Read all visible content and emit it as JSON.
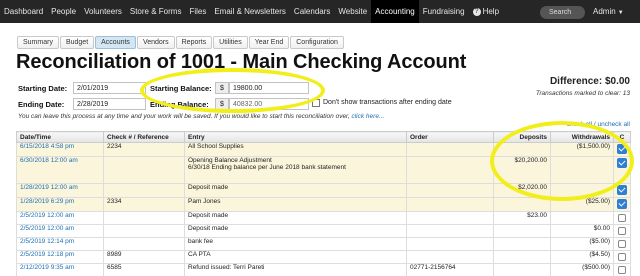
{
  "nav": {
    "items": [
      "Dashboard",
      "People",
      "Volunteers",
      "Store & Forms",
      "Files",
      "Email & Newsletters",
      "Calendars",
      "Website",
      "Accounting",
      "Fundraising"
    ],
    "active": "Accounting",
    "help": "Help",
    "search": "Search",
    "admin": "Admin"
  },
  "subtabs": [
    "Summary",
    "Budget",
    "Accounts",
    "Vendors",
    "Reports",
    "Utilities",
    "Year End",
    "Configuration"
  ],
  "active_subtab": "Accounts",
  "title": "Reconciliation of 1001 - Main Checking Account",
  "starting_date_label": "Starting Date:",
  "starting_date": "2/01/2019",
  "ending_date_label": "Ending Date:",
  "ending_date": "2/28/2019",
  "starting_balance_label": "Starting Balance:",
  "starting_balance": "19800.00",
  "ending_balance_label": "Ending Balance:",
  "ending_balance": "40832.00",
  "currency": "$",
  "dont_show_label": "Don't show transactions after ending date",
  "difference": "Difference: $0.00",
  "marked_to_clear": "Transactions marked to clear: 13",
  "note": "You can leave this process at any time and your work will be saved. If you would like to start this reconciliation over,",
  "note_link": "click here...",
  "check_all": "check all",
  "uncheck_all": "uncheck all",
  "check_sep": " / ",
  "columns": [
    "Date/Time",
    "Check # / Reference",
    "Entry",
    "Order",
    "Deposits",
    "Withdrawals",
    "C"
  ],
  "rows": [
    {
      "date": "6/15/2018 4:58 pm",
      "ref": "2234",
      "entry": "All School Supplies",
      "entry2": "",
      "order": "",
      "deposit": "",
      "withdrawal": "($1,500.00)",
      "cleared": true
    },
    {
      "date": "6/30/2018 12:00 am",
      "ref": "",
      "entry": "Opening Balance Adjustment",
      "entry2": "6/30/18 Ending balance per June 2018 bank statement",
      "order": "",
      "deposit": "$20,200.00",
      "withdrawal": "",
      "cleared": true
    },
    {
      "date": "1/28/2019 12:00 am",
      "ref": "",
      "entry": "Deposit made",
      "entry2": "",
      "order": "",
      "deposit": "$2,020.00",
      "withdrawal": "",
      "cleared": true
    },
    {
      "date": "1/28/2019 6:29 pm",
      "ref": "2334",
      "entry": "Pam Jones",
      "entry2": "",
      "order": "",
      "deposit": "",
      "withdrawal": "($25.00)",
      "cleared": true
    },
    {
      "date": "2/5/2019 12:00 am",
      "ref": "",
      "entry": "Deposit made",
      "entry2": "",
      "order": "",
      "deposit": "$23.00",
      "withdrawal": "",
      "cleared": false
    },
    {
      "date": "2/5/2019 12:00 am",
      "ref": "",
      "entry": "Deposit made",
      "entry2": "",
      "order": "",
      "deposit": "",
      "withdrawal": "$0.00",
      "cleared": false
    },
    {
      "date": "2/5/2019 12:14 pm",
      "ref": "",
      "entry": "bank fee",
      "entry2": "",
      "order": "",
      "deposit": "",
      "withdrawal": "($5.00)",
      "cleared": false
    },
    {
      "date": "2/5/2019 12:18 pm",
      "ref": "8989",
      "entry": "CA PTA",
      "entry2": "",
      "order": "",
      "deposit": "",
      "withdrawal": "($4.50)",
      "cleared": false
    },
    {
      "date": "2/12/2019 9:35 am",
      "ref": "6585",
      "entry": "Refund issued: Terri Pareti",
      "entry2": "",
      "order": "02771-2156764",
      "deposit": "",
      "withdrawal": "($500.00)",
      "cleared": false
    }
  ],
  "colors": {
    "nav_bg": "#262626",
    "link": "#1a6fb5",
    "cleared_row": "#fbf5dc",
    "checkbox": "#2e7fd6",
    "highlight": "#f2ee1a"
  }
}
